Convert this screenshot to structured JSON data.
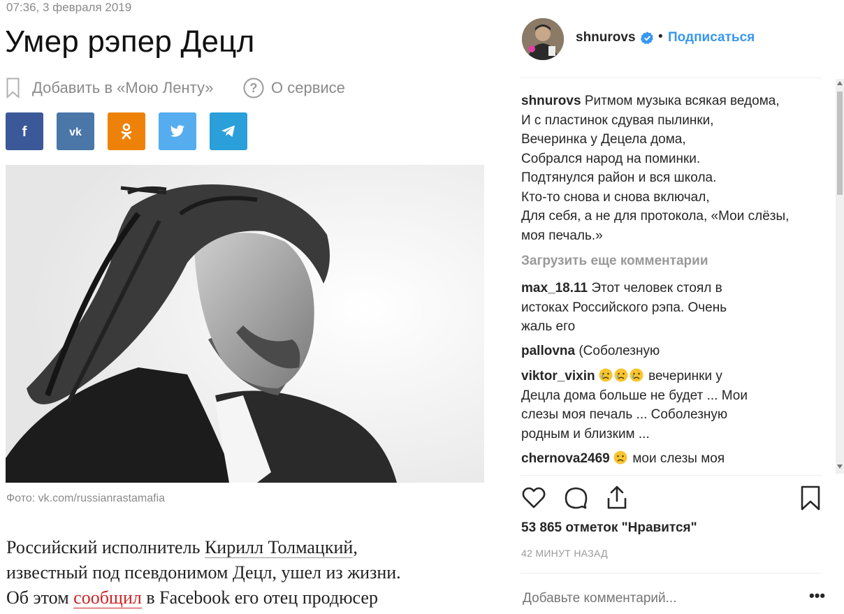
{
  "article": {
    "dateline": "07:36, 3 февраля 2019",
    "headline": "Умер рэпер Децл",
    "add_to_feed": "Добавить в «Мою Ленту»",
    "about_service": "О сервисе",
    "share": [
      {
        "network": "facebook",
        "glyph": "f",
        "color": "#3b5998"
      },
      {
        "network": "vkontakte",
        "glyph": "vk",
        "color": "#4a76a8"
      },
      {
        "network": "odnoklassniki",
        "glyph": "ok",
        "color": "#ee8208"
      },
      {
        "network": "twitter",
        "glyph": "tw",
        "color": "#55acee"
      },
      {
        "network": "telegram",
        "glyph": "tg",
        "color": "#2b9fd9"
      }
    ],
    "photo_caption": "Фото: vk.com/russianrastamafia",
    "lead": {
      "t1": "Российский исполнитель ",
      "link1": "Кирилл Толмацкий",
      "t2": ",",
      "t3": "известный под псевдонимом Децл, ушел из жизни.",
      "t4": "Об этом ",
      "link2": "сообщил",
      "t5": " в Facebook его отец продюсер"
    }
  },
  "instagram": {
    "username": "shnurovs",
    "dot": "•",
    "follow": "Подписаться",
    "caption_user": "shnurovs",
    "caption_lines": [
      "Ритмом музыка всякая ведома,",
      "И с пластинок сдувая пылинки,",
      "Вечеринка у Децела дома,",
      "Собрался народ на поминки.",
      "Подтянулся район и вся школа.",
      "Кто-то снова и снова включал,",
      "Для себя, а не для протокола, «Мои слёзы,",
      "моя печаль.»"
    ],
    "load_more": "Загрузить еще комментарии",
    "comments": [
      {
        "user": "max_18.11",
        "lines": [
          "Этот человек стоял в",
          "истоках Российского рэпа. Очень",
          "жаль его"
        ]
      },
      {
        "user": "pallovna",
        "lines": [
          "(Соболезную"
        ]
      },
      {
        "user": "viktor_vixin",
        "lines": [
          "вечеринки у",
          "Децла дома больше не будет ... Мои",
          "слезы моя печаль ... Соболезную",
          "родным и близким ..."
        ]
      },
      {
        "user": "chernova2469",
        "lines": [
          "мои слезы моя"
        ]
      }
    ],
    "likes": "53 865 отметок \"Нравится\"",
    "time_ago": "42 МИНУТ НАЗАД",
    "comment_placeholder": "Добавьте комментарий...",
    "more": "•••",
    "colors": {
      "link": "#3897f0",
      "text": "#262626",
      "muted": "#999999"
    }
  }
}
